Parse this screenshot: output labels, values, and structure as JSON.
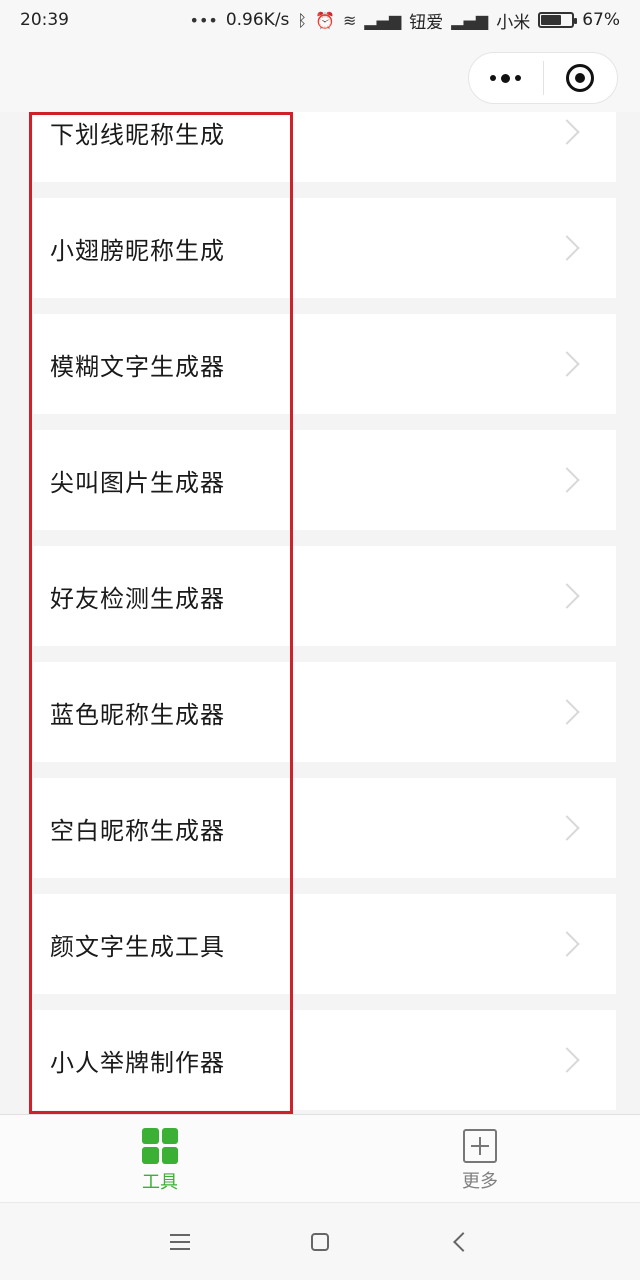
{
  "status_bar": {
    "time": "20:39",
    "dots": "•••",
    "network_speed": "0.96K/s",
    "carrier_1": "钮爱",
    "carrier_2": "小米",
    "battery": "67%"
  },
  "battery_level_percent": 67,
  "tools": [
    {
      "label": "下划线昵称生成"
    },
    {
      "label": "小翅膀昵称生成"
    },
    {
      "label": "模糊文字生成器"
    },
    {
      "label": "尖叫图片生成器"
    },
    {
      "label": "好友检测生成器"
    },
    {
      "label": "蓝色昵称生成器"
    },
    {
      "label": "空白昵称生成器"
    },
    {
      "label": "颜文字生成工具"
    },
    {
      "label": "小人举牌制作器"
    }
  ],
  "tab_bar": {
    "tools_label": "工具",
    "more_label": "更多"
  },
  "colors": {
    "accent_green": "#3cb035",
    "highlight_red": "#d0202c"
  }
}
